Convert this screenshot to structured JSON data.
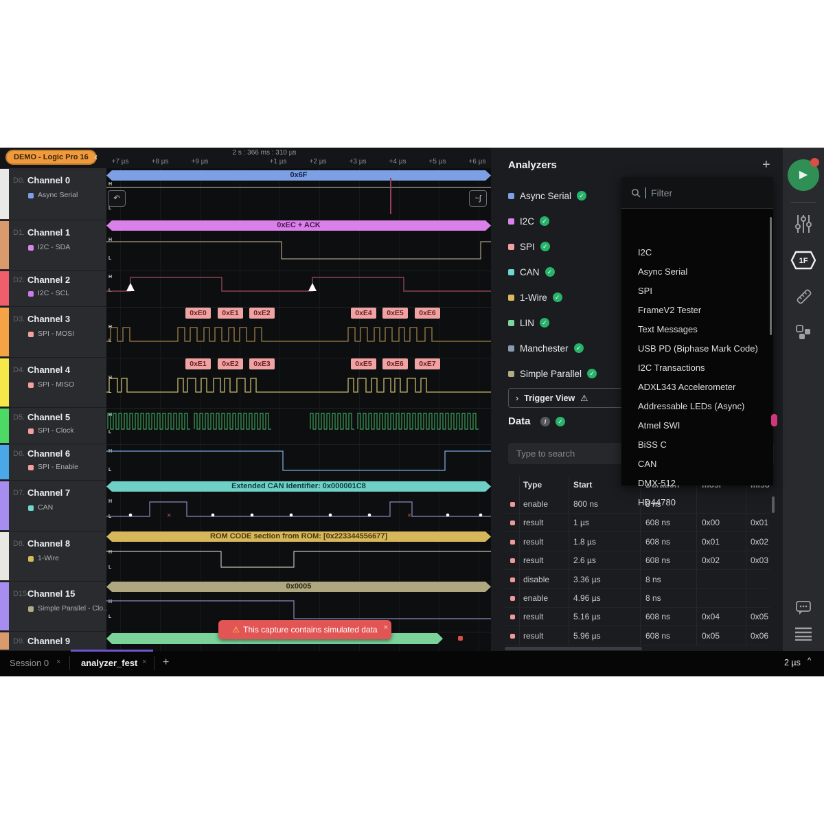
{
  "header": {
    "badge": "DEMO - Logic Pro 16",
    "timeline_label": "2 s : 366 ms : 310 µs",
    "ticks": [
      "+7 µs",
      "+8 µs",
      "+9 µs",
      "+1 µs",
      "+2 µs",
      "+3 µs",
      "+4 µs",
      "+5 µs",
      "+6 µs"
    ]
  },
  "icons": {
    "close": "×",
    "plus": "+",
    "back": "‹",
    "expand": "›",
    "check": "✓",
    "warning": "⚠",
    "info": "i",
    "play": "▶",
    "caret_up": "^",
    "frame_start": "↶",
    "frame_end": "~ʃ",
    "cross": "×"
  },
  "hl": {
    "h": "H",
    "l": "L"
  },
  "channels": [
    {
      "id": "D0.",
      "name": "Channel 0",
      "analyzer": "Async Serial",
      "strip": "#e9e9e7",
      "dot": "#7b9fe8"
    },
    {
      "id": "D1.",
      "name": "Channel 1",
      "analyzer": "I2C - SDA",
      "strip": "#d99a6c",
      "dot": "#d884ea"
    },
    {
      "id": "D2.",
      "name": "Channel 2",
      "analyzer": "I2C - SCL",
      "strip": "#ef5f6b",
      "dot": "#c77ded"
    },
    {
      "id": "D3.",
      "name": "Channel 3",
      "analyzer": "SPI - MOSI",
      "strip": "#f5a344",
      "dot": "#f2a0a0"
    },
    {
      "id": "D4.",
      "name": "Channel 4",
      "analyzer": "SPI - MISO",
      "strip": "#f7e84a",
      "dot": "#f2a0a0"
    },
    {
      "id": "D5.",
      "name": "Channel 5",
      "analyzer": "SPI - Clock",
      "strip": "#4cd964",
      "dot": "#f2a0a0"
    },
    {
      "id": "D6.",
      "name": "Channel 6",
      "analyzer": "SPI - Enable",
      "strip": "#4aa8e8",
      "dot": "#f2a0a0"
    },
    {
      "id": "D7.",
      "name": "Channel 7",
      "analyzer": "CAN",
      "strip": "#a78df0",
      "dot": "#6fd6cf"
    },
    {
      "id": "D8.",
      "name": "Channel 8",
      "analyzer": "1-Wire",
      "strip": "#e9e7e1",
      "dot": "#d9b95c"
    },
    {
      "id": "D15.",
      "name": "Channel 15",
      "analyzer": "Simple Parallel - Clo...",
      "strip": "#a78df0",
      "dot": "#b3ab84"
    },
    {
      "id": "D9.",
      "name": "Channel 9",
      "analyzer": "",
      "strip": "#d99a6c",
      "dot": ""
    }
  ],
  "annotations": {
    "d0": "0x6F",
    "d1": "0xEC + ACK",
    "d7": "Extended CAN Identifier: 0x000001C8",
    "d8": "ROM CODE section from ROM: [0x223344556677]",
    "d15": "0x0005"
  },
  "chips": {
    "d3": [
      "0xE0",
      "0xE1",
      "0xE2",
      "0xE4",
      "0xE5",
      "0xE6"
    ],
    "d4": [
      "0xE1",
      "0xE2",
      "0xE3",
      "0xE5",
      "0xE6",
      "0xE7"
    ]
  },
  "toast": {
    "text": "This capture contains simulated data"
  },
  "analyzers": {
    "title": "Analyzers",
    "items": [
      {
        "label": "Async Serial",
        "color": "#7b9fe8"
      },
      {
        "label": "I2C",
        "color": "#d884ea"
      },
      {
        "label": "SPI",
        "color": "#f2a0a0"
      },
      {
        "label": "CAN",
        "color": "#6fd6cf"
      },
      {
        "label": "1-Wire",
        "color": "#d9b95c"
      },
      {
        "label": "LIN",
        "color": "#7dd69a"
      },
      {
        "label": "Manchester",
        "color": "#8a9bb0"
      },
      {
        "label": "Simple Parallel",
        "color": "#b3ab84"
      }
    ],
    "trigger_view": "Trigger View"
  },
  "dropdown": {
    "placeholder": "Filter",
    "items": [
      "I2C",
      "Async Serial",
      "SPI",
      "FrameV2 Tester",
      "Text Messages",
      "USB PD (Biphase Mark Code)",
      "I2C Transactions",
      "ADXL343 Accelerometer",
      "Addressable LEDs (Async)",
      "Atmel SWI",
      "BiSS C",
      "CAN",
      "DMX-512",
      "HD44780"
    ]
  },
  "data_panel": {
    "title": "Data",
    "search_placeholder": "Type to search",
    "columns": [
      "Type",
      "Start",
      "Duration",
      "mosi",
      "miso"
    ],
    "rows": [
      {
        "type": "enable",
        "start": "800 ns",
        "duration": "8 ns",
        "mosi": "",
        "miso": ""
      },
      {
        "type": "result",
        "start": "1 µs",
        "duration": "608 ns",
        "mosi": "0x00",
        "miso": "0x01"
      },
      {
        "type": "result",
        "start": "1.8 µs",
        "duration": "608 ns",
        "mosi": "0x01",
        "miso": "0x02"
      },
      {
        "type": "result",
        "start": "2.6 µs",
        "duration": "608 ns",
        "mosi": "0x02",
        "miso": "0x03"
      },
      {
        "type": "disable",
        "start": "3.36 µs",
        "duration": "8 ns",
        "mosi": "",
        "miso": ""
      },
      {
        "type": "enable",
        "start": "4.96 µs",
        "duration": "8 ns",
        "mosi": "",
        "miso": ""
      },
      {
        "type": "result",
        "start": "5.16 µs",
        "duration": "608 ns",
        "mosi": "0x04",
        "miso": "0x05"
      },
      {
        "type": "result",
        "start": "5.96 µs",
        "duration": "608 ns",
        "mosi": "0x05",
        "miso": "0x06"
      }
    ]
  },
  "sidebar": {
    "hex_badge": "1F"
  },
  "tabs": {
    "session": "Session 0",
    "active": "analyzer_fest"
  },
  "statusbar": {
    "zoom": "2 µs"
  },
  "colors": {
    "accent_green": "#2f8f55",
    "warning_red": "#e25555",
    "tab_indicator": "#6e56cf",
    "badge_orange": "#ef9a3d"
  }
}
